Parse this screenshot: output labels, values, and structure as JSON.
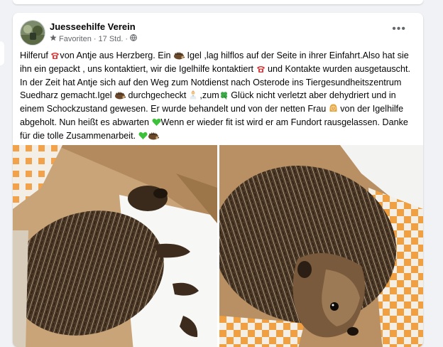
{
  "post": {
    "page_name": "Juesseehilfe Verein",
    "favorites_label": "Favoriten",
    "separator": "·",
    "time": "17 Std.",
    "more_label": "•••",
    "text": {
      "s1": "Hilferuf ",
      "s2": "von Antje aus Herzberg. Ein ",
      "s3": " Igel ,lag hilflos auf der Seite  in ihrer Einfahrt.Also hat sie ihn ein gepackt , uns kontaktiert, wir  die Igelhilfe kontaktiert ",
      "s4": " und Kontakte wurden ausgetauscht. In der Zeit hat Antje sich auf den Weg zum Notdienst nach Osterode ins Tiergesundheitszentrum Suedharz gemacht.Igel ",
      "s5": " durchgecheckt ",
      "s6": " ,zum",
      "s7": " Glück nicht verletzt aber dehydriert und in einem Schockzustand gewesen. Er wurde behandelt und von der netten Frau ",
      "s8": " von der Igelhilfe abgeholt. Nun heißt es abwarten ",
      "s9": "Wenn er wieder fit ist wird er am Fundort  rausgelassen. Danke für die tolle Zusammenarbeit. "
    },
    "emoji_names": [
      "telephone-icon",
      "hedgehog-icon",
      "doctor-icon",
      "four-leaf-clover-icon",
      "woman-icon",
      "green-heart-icon"
    ]
  },
  "colors": {
    "background": "#f0f2f5",
    "card": "#ffffff",
    "primary_text": "#050505",
    "secondary_text": "#65676b",
    "phone_red": "#d93a3a",
    "heart_green": "#3cc13b"
  }
}
